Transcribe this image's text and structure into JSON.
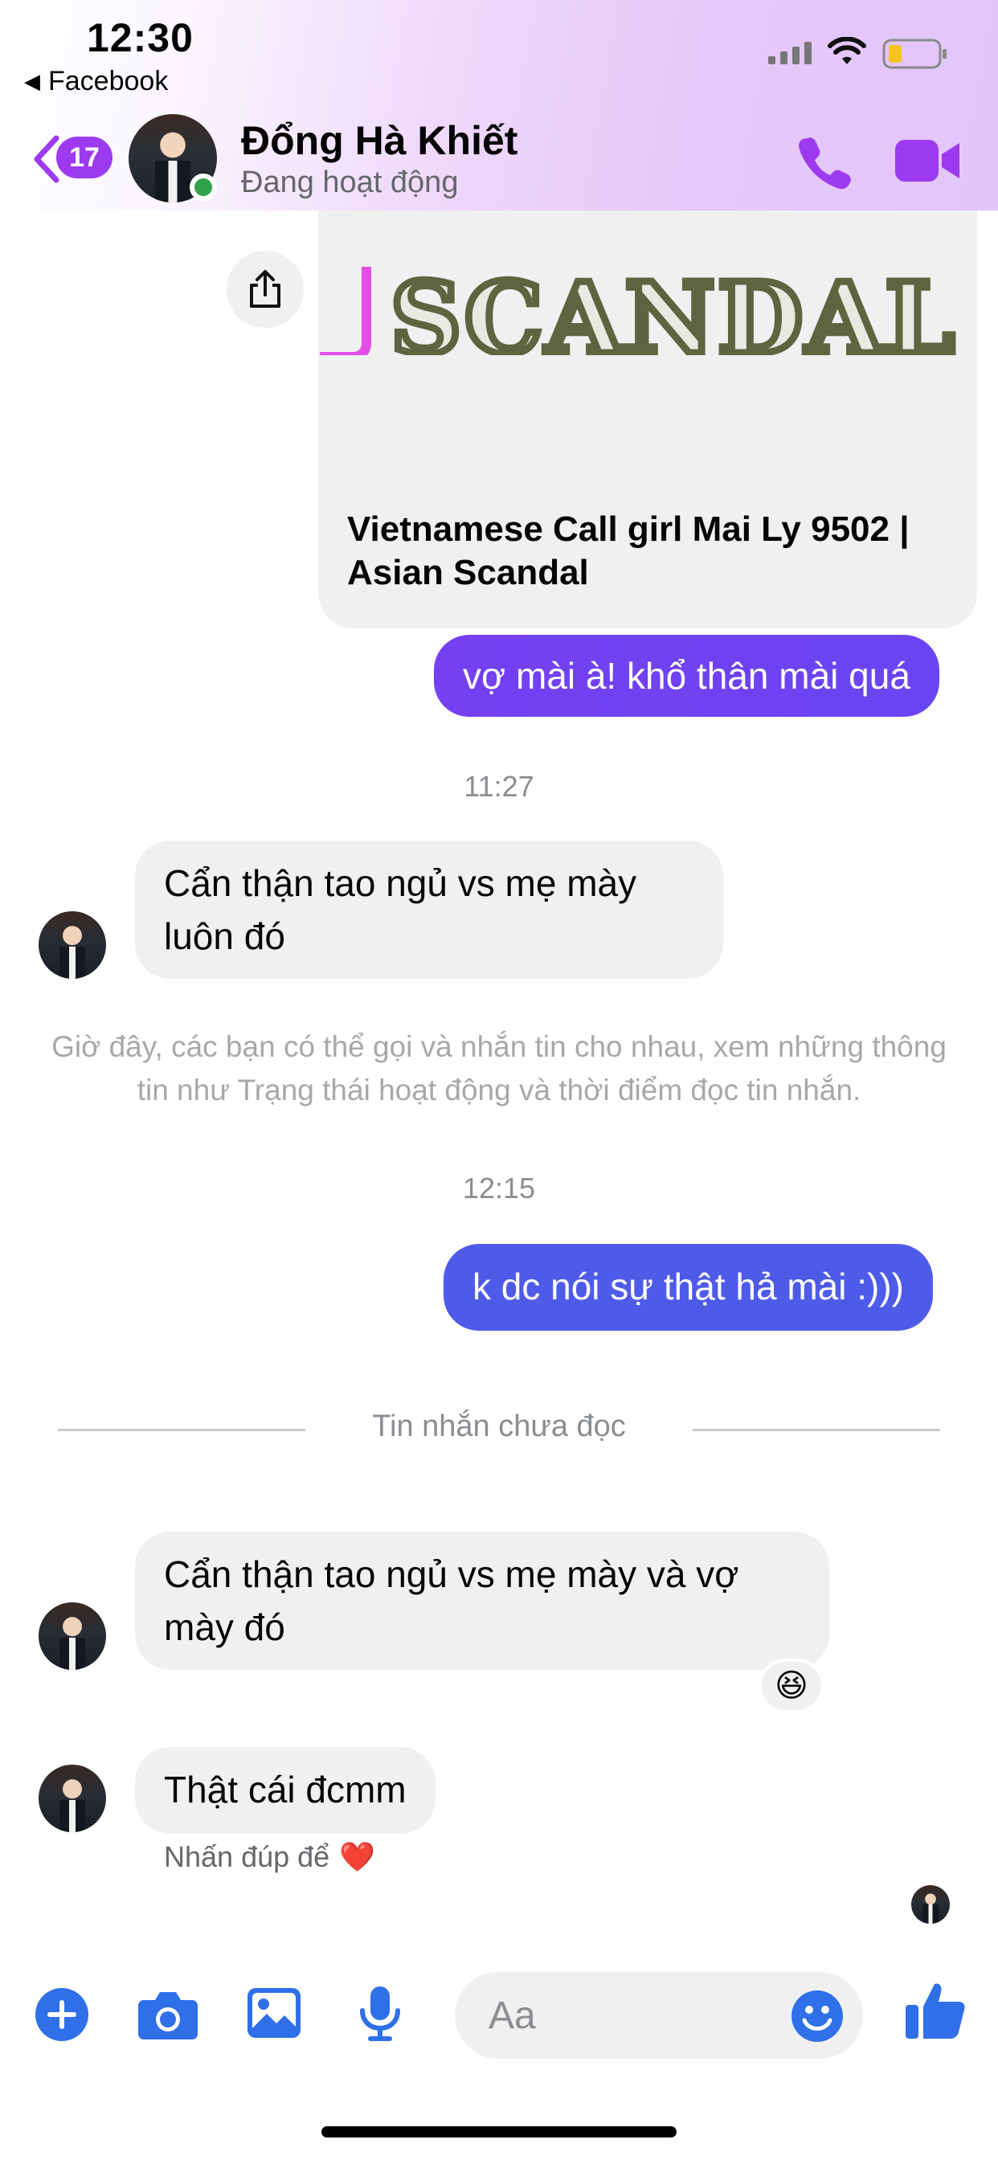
{
  "status_bar": {
    "time": "12:30",
    "back_app_label": "Facebook"
  },
  "header": {
    "unread_badge": "17",
    "contact_name": "Đổng Hà Khiết",
    "contact_status": "Đang hoạt động"
  },
  "link_card": {
    "banner_text": "SCANDAL",
    "title": "Vietnamese Call girl Mai Ly 9502 | Asian Scandal"
  },
  "messages": {
    "out_1": "vợ mài à! khổ thân mài quá",
    "timestamp_1": "11:27",
    "in_1": "Cẩn thận tao ngủ vs mẹ mày luôn đó",
    "system_notice": "Giờ đây, các bạn có thể gọi và nhắn tin cho nhau, xem những thông tin như Trạng thái hoạt động và thời điểm đọc tin nhắn.",
    "timestamp_2": "12:15",
    "out_2": "k dc nói sự thật hả mài :)))",
    "unread_divider": "Tin nhắn chưa đọc",
    "in_2": "Cẩn thận tao ngủ vs mẹ mày và vợ mày đó",
    "in_2_reaction": "😆",
    "in_3": "Thật cái đcmm",
    "double_tap_hint": "Nhấn đúp để",
    "double_tap_heart": "❤️"
  },
  "composer": {
    "placeholder": "Aa"
  },
  "colors": {
    "accent_purple": "#9d3af0",
    "outgoing_bubble_1": "#7440f2",
    "outgoing_bubble_2": "#4e5be9",
    "composer_icon_blue": "#2f6fe8"
  }
}
